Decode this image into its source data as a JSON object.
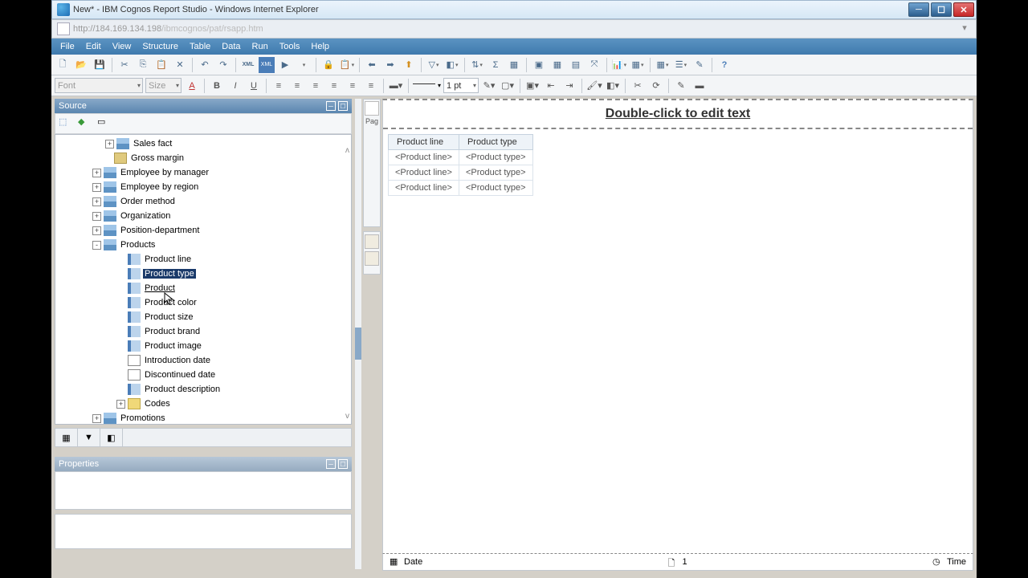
{
  "window": {
    "title": "New* - IBM Cognos Report Studio - Windows Internet Explorer"
  },
  "address": {
    "url_host": "http://184.169.134.198",
    "url_path": "/ibmcognos/pat/rsapp.htm"
  },
  "menu": {
    "file": "File",
    "edit": "Edit",
    "view": "View",
    "structure": "Structure",
    "table": "Table",
    "data": "Data",
    "run": "Run",
    "tools": "Tools",
    "help": "Help"
  },
  "format": {
    "font_ph": "Font",
    "size_ph": "Size",
    "line_pt": "1 pt"
  },
  "source": {
    "header": "Source"
  },
  "properties": {
    "header": "Properties"
  },
  "tree": {
    "items": [
      {
        "indent": 62,
        "exp": "+",
        "icon": "dim",
        "label": "Sales fact"
      },
      {
        "indent": 73,
        "icon": "fx",
        "label": "Gross margin"
      },
      {
        "indent": 46,
        "exp": "+",
        "icon": "dim",
        "label": "Employee by manager"
      },
      {
        "indent": 46,
        "exp": "+",
        "icon": "dim",
        "label": "Employee by region"
      },
      {
        "indent": 46,
        "exp": "+",
        "icon": "dim",
        "label": "Order method"
      },
      {
        "indent": 46,
        "exp": "+",
        "icon": "dim",
        "label": "Organization"
      },
      {
        "indent": 46,
        "exp": "+",
        "icon": "dim",
        "label": "Position-department"
      },
      {
        "indent": 46,
        "exp": "-",
        "icon": "dim",
        "label": "Products"
      },
      {
        "indent": 90,
        "icon": "col",
        "label": "Product line"
      },
      {
        "indent": 90,
        "icon": "col",
        "label": "Product type",
        "sel": true
      },
      {
        "indent": 90,
        "icon": "col",
        "label": "Product",
        "hov": true
      },
      {
        "indent": 90,
        "icon": "col",
        "label": "Product color"
      },
      {
        "indent": 90,
        "icon": "col",
        "label": "Product size"
      },
      {
        "indent": 90,
        "icon": "col",
        "label": "Product brand"
      },
      {
        "indent": 90,
        "icon": "col",
        "label": "Product image"
      },
      {
        "indent": 90,
        "icon": "date",
        "label": "Introduction date"
      },
      {
        "indent": 90,
        "icon": "date",
        "label": "Discontinued date"
      },
      {
        "indent": 90,
        "icon": "col",
        "label": "Product description"
      },
      {
        "indent": 76,
        "exp": "+",
        "icon": "folder",
        "label": "Codes"
      },
      {
        "indent": 46,
        "exp": "+",
        "icon": "dim",
        "label": "Promotions"
      }
    ]
  },
  "page": {
    "tool_label": "Pag"
  },
  "report": {
    "title_placeholder": "Double-click to edit text",
    "columns": [
      "Product line",
      "Product type"
    ],
    "cells": [
      "<Product line>",
      "<Product type>"
    ]
  },
  "footer": {
    "date": "Date",
    "page": "1",
    "time": "Time"
  }
}
